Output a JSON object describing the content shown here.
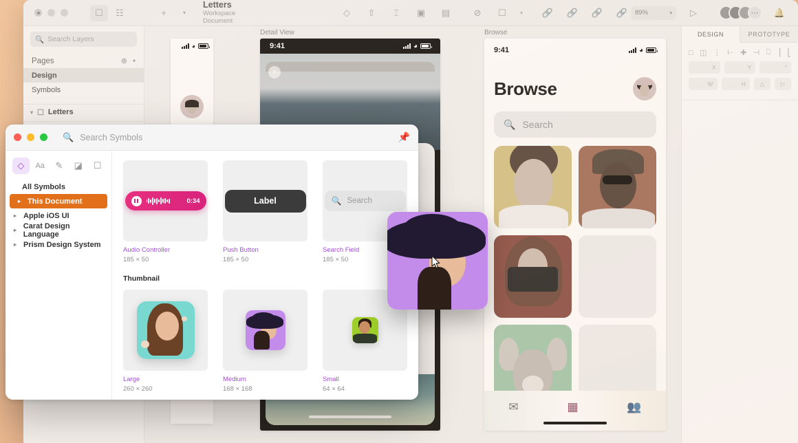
{
  "app": {
    "document_title": "Letters",
    "document_subtitle": "Workspace Document",
    "zoom_level": "89%",
    "toolbar_icons": [
      "plus-icon",
      "chevron-down-icon",
      "mask-icon",
      "distribute-icon",
      "flow-icon",
      "scale-icon",
      "boolean-icon",
      "rotate-icon",
      "transform-icon",
      "link-icon",
      "unlink-icon",
      "detach-icon",
      "symbol-icon",
      "play-icon",
      "notification-bell-icon"
    ],
    "view_toggle_icons": [
      "artboard-view-icon",
      "grid-view-icon"
    ]
  },
  "layers_panel": {
    "search_placeholder": "Search Layers",
    "pages_label": "Pages",
    "pages": [
      {
        "label": "Design",
        "active": true
      },
      {
        "label": "Symbols",
        "active": false
      }
    ],
    "layers": [
      {
        "label": "Letters",
        "icon": "artboard-icon"
      }
    ]
  },
  "canvas": {
    "artboards": [
      {
        "label": "Detail View"
      },
      {
        "label": "Browse"
      }
    ],
    "detail_view": {
      "label": "Detail View",
      "status_time": "9:41",
      "close_label": "×"
    },
    "browse": {
      "label": "Browse",
      "status_time": "9:41",
      "title": "Browse",
      "search_placeholder": "Search",
      "tiles": [
        {
          "name": "woman-yellow",
          "bg": "#f5c518",
          "empty": false
        },
        {
          "name": "man-orange",
          "bg": "#ef5f22",
          "empty": false
        },
        {
          "name": "woman-camera-red",
          "bg": "#e23a1f",
          "empty": false
        },
        {
          "name": "placeholder-1",
          "bg": "#efefef",
          "empty": true
        },
        {
          "name": "dog-green",
          "bg": "#6fdc8c",
          "empty": false
        },
        {
          "name": "placeholder-2",
          "bg": "#efefef",
          "empty": true
        }
      ],
      "tabs": [
        {
          "name": "mail-tab",
          "icon": "envelope-image-icon",
          "active": false
        },
        {
          "name": "grid-tab",
          "icon": "grid-icon",
          "active": true
        },
        {
          "name": "people-tab",
          "icon": "people-icon",
          "active": false
        }
      ],
      "accent_color": "#e8307f"
    }
  },
  "inspector": {
    "tabs": [
      {
        "label": "DESIGN",
        "active": true
      },
      {
        "label": "PROTOTYPE",
        "active": false
      }
    ],
    "align_icons": [
      "align-left-icon",
      "align-center-h-icon",
      "align-right-icon",
      "align-top-icon",
      "align-middle-icon",
      "align-bottom-icon",
      "distribute-h-icon",
      "distribute-v-icon"
    ],
    "fields": [
      {
        "label": "X"
      },
      {
        "label": "Y"
      },
      {
        "label": "°"
      },
      {
        "label": "W"
      },
      {
        "label": "H"
      }
    ],
    "corner_icons": [
      "corner-radius-icon",
      "flip-icon"
    ]
  },
  "symbols_window": {
    "search_placeholder": "Search Symbols",
    "pin_icon": "pin-icon",
    "traffic_lights": [
      "close",
      "minimize",
      "zoom"
    ],
    "filter_tabs": [
      {
        "name": "symbols-tab",
        "icon": "diamond-icon",
        "active": true
      },
      {
        "name": "text-styles-tab",
        "icon": "text-icon",
        "active": false
      },
      {
        "name": "layer-styles-tab",
        "icon": "brush-icon",
        "active": false
      },
      {
        "name": "colors-tab",
        "icon": "swatch-icon",
        "active": false
      },
      {
        "name": "artboards-tab",
        "icon": "artboard-icon",
        "active": false
      }
    ],
    "libraries": [
      {
        "label": "All Symbols",
        "selected": false,
        "expandable": false
      },
      {
        "label": "This Document",
        "selected": true,
        "expandable": true
      },
      {
        "label": "Apple iOS UI",
        "selected": false,
        "expandable": true
      },
      {
        "label": "Carat Design Language",
        "selected": false,
        "expandable": true
      },
      {
        "label": "Prism Design System",
        "selected": false,
        "expandable": true
      }
    ],
    "selected_color": "#e2701b",
    "name_color": "#a44fd8",
    "sections": [
      {
        "heading": "",
        "items": [
          {
            "name": "Audio Controller",
            "size": "185 × 50",
            "kind": "audio",
            "time": "0:34"
          },
          {
            "name": "Push Button",
            "size": "185 × 50",
            "kind": "button",
            "label": "Label"
          },
          {
            "name": "Search Field",
            "size": "185 × 50",
            "kind": "search",
            "placeholder": "Search"
          }
        ]
      },
      {
        "heading": "Thumbnail",
        "items": [
          {
            "name": "Large",
            "size": "260 × 260",
            "kind": "thumb-large"
          },
          {
            "name": "Medium",
            "size": "168 × 168",
            "kind": "thumb-medium"
          },
          {
            "name": "Small",
            "size": "64 × 64",
            "kind": "thumb-small"
          }
        ]
      }
    ]
  },
  "drag": {
    "item_name": "Medium",
    "cursor": "arrow-cursor"
  }
}
